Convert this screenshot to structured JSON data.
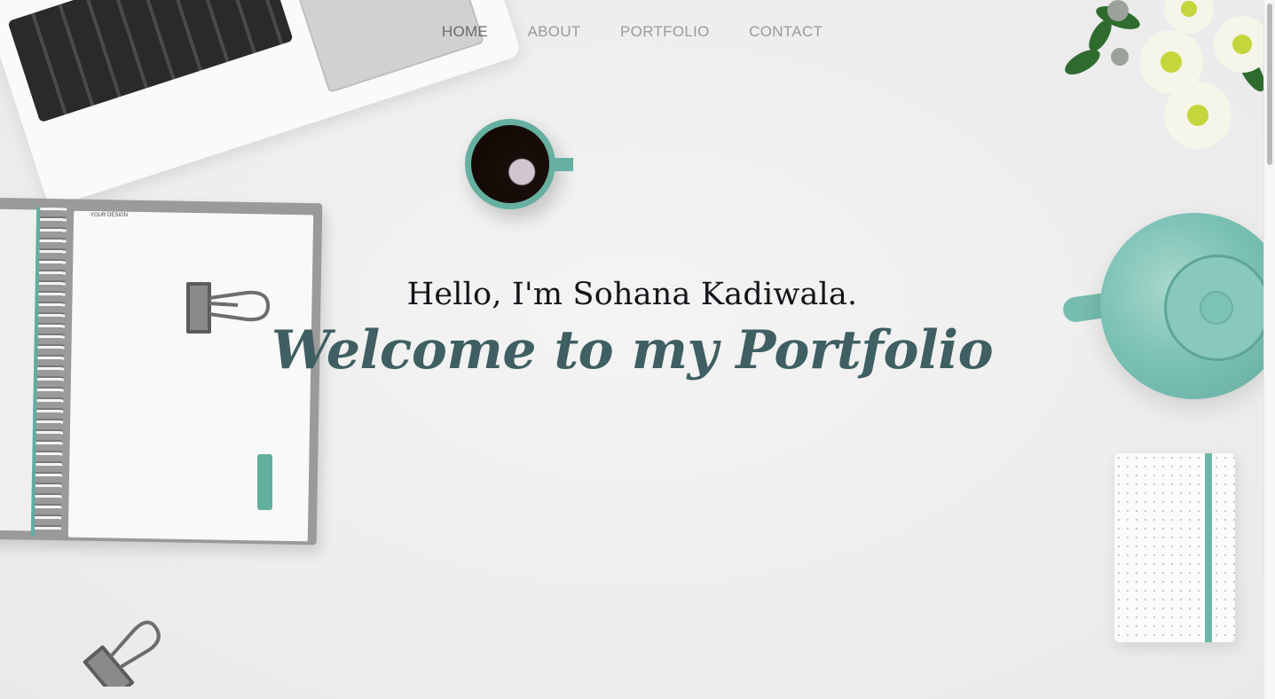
{
  "nav": {
    "items": [
      {
        "label": "HOME",
        "active": true
      },
      {
        "label": "ABOUT",
        "active": false
      },
      {
        "label": "PORTFOLIO",
        "active": false
      },
      {
        "label": "CONTACT",
        "active": false
      }
    ]
  },
  "hero": {
    "greeting": "Hello, I'm Sohana Kadiwala.",
    "tagline": "Welcome to my Portfolio",
    "notebook_brand": "YOUR DESIGN"
  },
  "colors": {
    "accent": "#3f5f62",
    "mint": "#66b0a2",
    "nav_text": "#9a9a9a",
    "background": "#efefef"
  },
  "decor_icons": [
    "laptop-image",
    "coffee-cup-image",
    "notebook-image",
    "binder-clip-image",
    "flowers-image",
    "teapot-image",
    "dot-notebook-image"
  ]
}
